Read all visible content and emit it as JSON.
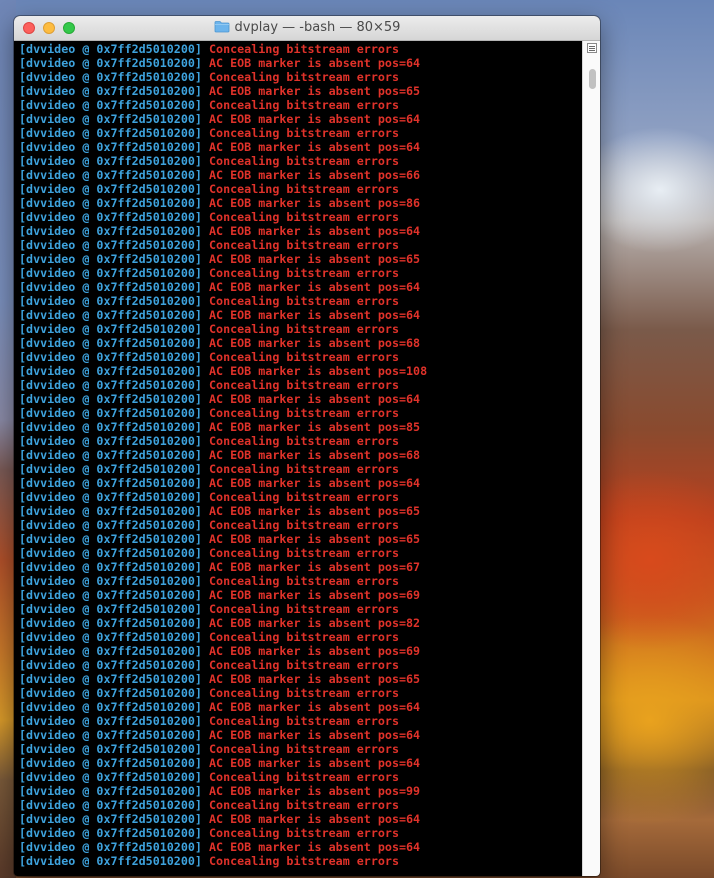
{
  "window": {
    "title": "dvplay — -bash — 80×59",
    "folder_icon": "folder-icon"
  },
  "colors": {
    "prefix": "#3ea3de",
    "message": "#e0322a",
    "terminal_bg": "#000000"
  },
  "terminal": {
    "lines": [
      {
        "prefix": "[dvvideo @ 0x7ff2d5010200]",
        "message": "Concealing bitstream errors"
      },
      {
        "prefix": "[dvvideo @ 0x7ff2d5010200]",
        "message": "AC EOB marker is absent pos=64"
      },
      {
        "prefix": "[dvvideo @ 0x7ff2d5010200]",
        "message": "Concealing bitstream errors"
      },
      {
        "prefix": "[dvvideo @ 0x7ff2d5010200]",
        "message": "AC EOB marker is absent pos=65"
      },
      {
        "prefix": "[dvvideo @ 0x7ff2d5010200]",
        "message": "Concealing bitstream errors"
      },
      {
        "prefix": "[dvvideo @ 0x7ff2d5010200]",
        "message": "AC EOB marker is absent pos=64"
      },
      {
        "prefix": "[dvvideo @ 0x7ff2d5010200]",
        "message": "Concealing bitstream errors"
      },
      {
        "prefix": "[dvvideo @ 0x7ff2d5010200]",
        "message": "AC EOB marker is absent pos=64"
      },
      {
        "prefix": "[dvvideo @ 0x7ff2d5010200]",
        "message": "Concealing bitstream errors"
      },
      {
        "prefix": "[dvvideo @ 0x7ff2d5010200]",
        "message": "AC EOB marker is absent pos=66"
      },
      {
        "prefix": "[dvvideo @ 0x7ff2d5010200]",
        "message": "Concealing bitstream errors"
      },
      {
        "prefix": "[dvvideo @ 0x7ff2d5010200]",
        "message": "AC EOB marker is absent pos=86"
      },
      {
        "prefix": "[dvvideo @ 0x7ff2d5010200]",
        "message": "Concealing bitstream errors"
      },
      {
        "prefix": "[dvvideo @ 0x7ff2d5010200]",
        "message": "AC EOB marker is absent pos=64"
      },
      {
        "prefix": "[dvvideo @ 0x7ff2d5010200]",
        "message": "Concealing bitstream errors"
      },
      {
        "prefix": "[dvvideo @ 0x7ff2d5010200]",
        "message": "AC EOB marker is absent pos=65"
      },
      {
        "prefix": "[dvvideo @ 0x7ff2d5010200]",
        "message": "Concealing bitstream errors"
      },
      {
        "prefix": "[dvvideo @ 0x7ff2d5010200]",
        "message": "AC EOB marker is absent pos=64"
      },
      {
        "prefix": "[dvvideo @ 0x7ff2d5010200]",
        "message": "Concealing bitstream errors"
      },
      {
        "prefix": "[dvvideo @ 0x7ff2d5010200]",
        "message": "AC EOB marker is absent pos=64"
      },
      {
        "prefix": "[dvvideo @ 0x7ff2d5010200]",
        "message": "Concealing bitstream errors"
      },
      {
        "prefix": "[dvvideo @ 0x7ff2d5010200]",
        "message": "AC EOB marker is absent pos=68"
      },
      {
        "prefix": "[dvvideo @ 0x7ff2d5010200]",
        "message": "Concealing bitstream errors"
      },
      {
        "prefix": "[dvvideo @ 0x7ff2d5010200]",
        "message": "AC EOB marker is absent pos=108"
      },
      {
        "prefix": "[dvvideo @ 0x7ff2d5010200]",
        "message": "Concealing bitstream errors"
      },
      {
        "prefix": "[dvvideo @ 0x7ff2d5010200]",
        "message": "AC EOB marker is absent pos=64"
      },
      {
        "prefix": "[dvvideo @ 0x7ff2d5010200]",
        "message": "Concealing bitstream errors"
      },
      {
        "prefix": "[dvvideo @ 0x7ff2d5010200]",
        "message": "AC EOB marker is absent pos=85"
      },
      {
        "prefix": "[dvvideo @ 0x7ff2d5010200]",
        "message": "Concealing bitstream errors"
      },
      {
        "prefix": "[dvvideo @ 0x7ff2d5010200]",
        "message": "AC EOB marker is absent pos=68"
      },
      {
        "prefix": "[dvvideo @ 0x7ff2d5010200]",
        "message": "Concealing bitstream errors"
      },
      {
        "prefix": "[dvvideo @ 0x7ff2d5010200]",
        "message": "AC EOB marker is absent pos=64"
      },
      {
        "prefix": "[dvvideo @ 0x7ff2d5010200]",
        "message": "Concealing bitstream errors"
      },
      {
        "prefix": "[dvvideo @ 0x7ff2d5010200]",
        "message": "AC EOB marker is absent pos=65"
      },
      {
        "prefix": "[dvvideo @ 0x7ff2d5010200]",
        "message": "Concealing bitstream errors"
      },
      {
        "prefix": "[dvvideo @ 0x7ff2d5010200]",
        "message": "AC EOB marker is absent pos=65"
      },
      {
        "prefix": "[dvvideo @ 0x7ff2d5010200]",
        "message": "Concealing bitstream errors"
      },
      {
        "prefix": "[dvvideo @ 0x7ff2d5010200]",
        "message": "AC EOB marker is absent pos=67"
      },
      {
        "prefix": "[dvvideo @ 0x7ff2d5010200]",
        "message": "Concealing bitstream errors"
      },
      {
        "prefix": "[dvvideo @ 0x7ff2d5010200]",
        "message": "AC EOB marker is absent pos=69"
      },
      {
        "prefix": "[dvvideo @ 0x7ff2d5010200]",
        "message": "Concealing bitstream errors"
      },
      {
        "prefix": "[dvvideo @ 0x7ff2d5010200]",
        "message": "AC EOB marker is absent pos=82"
      },
      {
        "prefix": "[dvvideo @ 0x7ff2d5010200]",
        "message": "Concealing bitstream errors"
      },
      {
        "prefix": "[dvvideo @ 0x7ff2d5010200]",
        "message": "AC EOB marker is absent pos=69"
      },
      {
        "prefix": "[dvvideo @ 0x7ff2d5010200]",
        "message": "Concealing bitstream errors"
      },
      {
        "prefix": "[dvvideo @ 0x7ff2d5010200]",
        "message": "AC EOB marker is absent pos=65"
      },
      {
        "prefix": "[dvvideo @ 0x7ff2d5010200]",
        "message": "Concealing bitstream errors"
      },
      {
        "prefix": "[dvvideo @ 0x7ff2d5010200]",
        "message": "AC EOB marker is absent pos=64"
      },
      {
        "prefix": "[dvvideo @ 0x7ff2d5010200]",
        "message": "Concealing bitstream errors"
      },
      {
        "prefix": "[dvvideo @ 0x7ff2d5010200]",
        "message": "AC EOB marker is absent pos=64"
      },
      {
        "prefix": "[dvvideo @ 0x7ff2d5010200]",
        "message": "Concealing bitstream errors"
      },
      {
        "prefix": "[dvvideo @ 0x7ff2d5010200]",
        "message": "AC EOB marker is absent pos=64"
      },
      {
        "prefix": "[dvvideo @ 0x7ff2d5010200]",
        "message": "Concealing bitstream errors"
      },
      {
        "prefix": "[dvvideo @ 0x7ff2d5010200]",
        "message": "AC EOB marker is absent pos=99"
      },
      {
        "prefix": "[dvvideo @ 0x7ff2d5010200]",
        "message": "Concealing bitstream errors"
      },
      {
        "prefix": "[dvvideo @ 0x7ff2d5010200]",
        "message": "AC EOB marker is absent pos=64"
      },
      {
        "prefix": "[dvvideo @ 0x7ff2d5010200]",
        "message": "Concealing bitstream errors"
      },
      {
        "prefix": "[dvvideo @ 0x7ff2d5010200]",
        "message": "AC EOB marker is absent pos=64"
      },
      {
        "prefix": "[dvvideo @ 0x7ff2d5010200]",
        "message": "Concealing bitstream errors"
      }
    ]
  },
  "scrollbar": {
    "menu_icon": "list-menu-icon"
  }
}
